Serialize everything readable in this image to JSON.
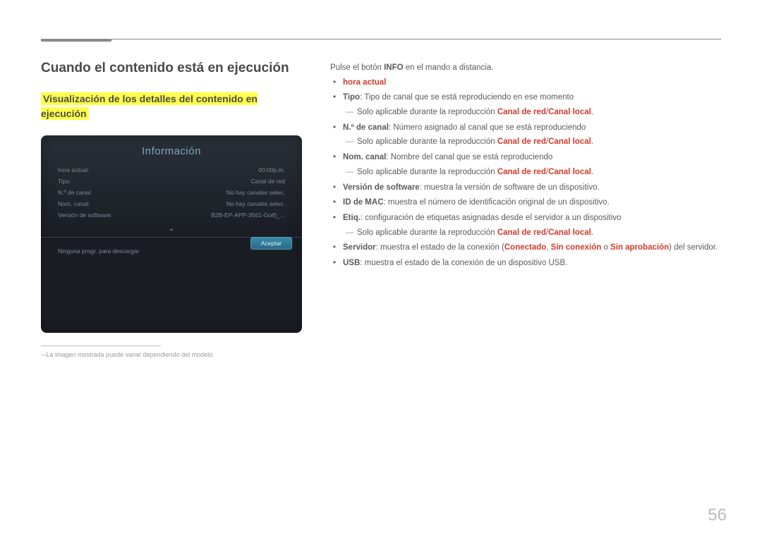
{
  "page_number": "56",
  "h1": "Cuando el contenido está en ejecución",
  "h2": "Visualización de los detalles del contenido en ejecución",
  "infobox": {
    "title": "Información",
    "rows": [
      {
        "k": "hora actual:",
        "v": "00:00p.m."
      },
      {
        "k": "Tipo:",
        "v": "Canal de red"
      },
      {
        "k": "N.º de canal:",
        "v": "No hay canales selec."
      },
      {
        "k": "Nom. canal:",
        "v": "No hay canales selec."
      },
      {
        "k": "Versión de software:",
        "v": "B2B-EP-APP-3561-Golf)_..."
      }
    ],
    "bottom_text": "Ninguna progr. para descargar",
    "aceptar": "Aceptar"
  },
  "footnote": "La imagen mostrada puede variar dependiendo del modelo.",
  "right": {
    "intro_pre": "Pulse el botón ",
    "intro_bold": "INFO",
    "intro_post": " en el mando a distancia.",
    "hora_actual": "hora actual",
    "tipo_b": "Tipo",
    "tipo_t": ": Tipo de canal que se está reproduciendo en ese momento",
    "sub_pre": "Solo aplicable durante la reproducción ",
    "sub_red1": "Canal de red",
    "sub_sep": "/",
    "sub_red2": "Canal local",
    "sub_post": ".",
    "ncanal_b": "N.º de canal",
    "ncanal_t": ": Número asignado al canal que se está reproduciendo",
    "nomcanal_b": "Nom. canal",
    "nomcanal_t": ": Nombre del canal que se está reproduciendo",
    "version_b": "Versión de software",
    "version_t": ": muestra la versión de software de un dispositivo.",
    "mac_b": "ID de MAC",
    "mac_t": ": muestra el número de identificación original de un dispositivo.",
    "etiq_b": "Etiq.",
    "etiq_t": ": configuración de etiquetas asignadas desde el servidor a un dispositivo",
    "servidor_b": "Servidor",
    "servidor_t1": ": muestra el estado de la conexión (",
    "servidor_r1": "Conectado",
    "servidor_s1": ", ",
    "servidor_r2": "Sin conexión",
    "servidor_s2": " o ",
    "servidor_r3": "Sin aprobación",
    "servidor_t2": ") del servidor.",
    "usb_b": "USB",
    "usb_t": ": muestra el estado de la conexión de un dispositivo USB."
  }
}
